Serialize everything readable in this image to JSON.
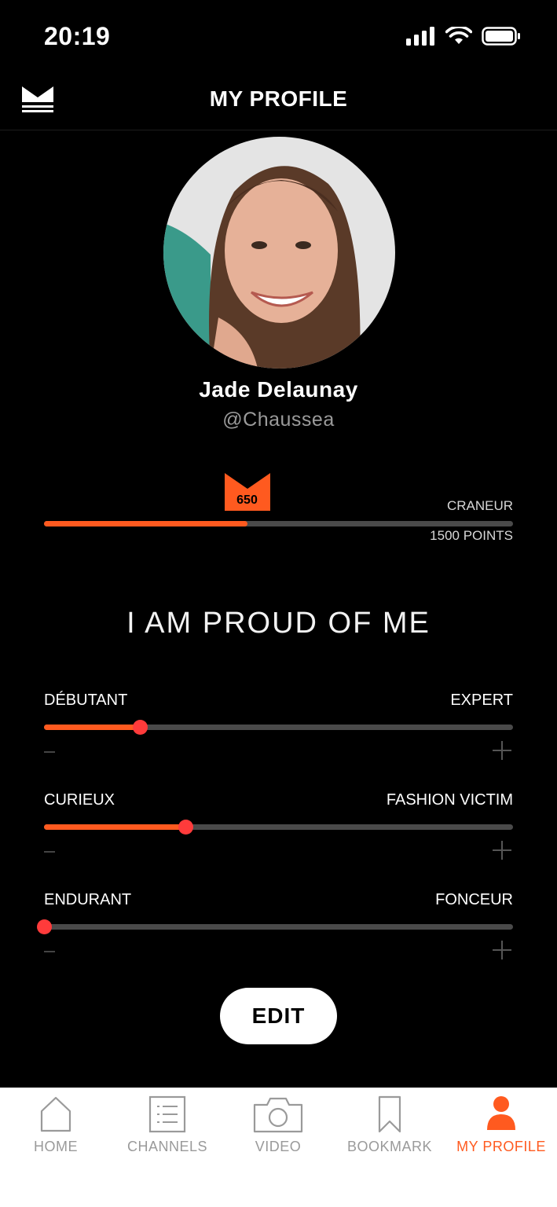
{
  "status": {
    "time": "20:19"
  },
  "header": {
    "title": "MY PROFILE"
  },
  "profile": {
    "name": "Jade Delaunay",
    "handle": "@Chaussea"
  },
  "points": {
    "current": "650",
    "level": "CRANEUR",
    "max": "1500 POINTS",
    "progress": 0.433
  },
  "motto": "I AM PROUD OF ME",
  "sliders": [
    {
      "left": "DÉBUTANT",
      "right": "EXPERT",
      "value": 0.205
    },
    {
      "left": "CURIEUX",
      "right": "FASHION VICTIM",
      "value": 0.302
    },
    {
      "left": "ENDURANT",
      "right": "FONCEUR",
      "value": 0.0
    }
  ],
  "edit_label": "EDIT",
  "tabs": [
    {
      "label": "HOME",
      "icon": "home-icon"
    },
    {
      "label": "CHANNELS",
      "icon": "channels-icon"
    },
    {
      "label": "VIDEO",
      "icon": "camera-icon"
    },
    {
      "label": "BOOKMARK",
      "icon": "bookmark-icon"
    },
    {
      "label": "MY PROFILE",
      "icon": "profile-icon",
      "active": true
    }
  ],
  "colors": {
    "accent": "#ff5a1f",
    "thumb": "#ff3b3b",
    "track": "#4a4a4a",
    "background": "#000000"
  }
}
